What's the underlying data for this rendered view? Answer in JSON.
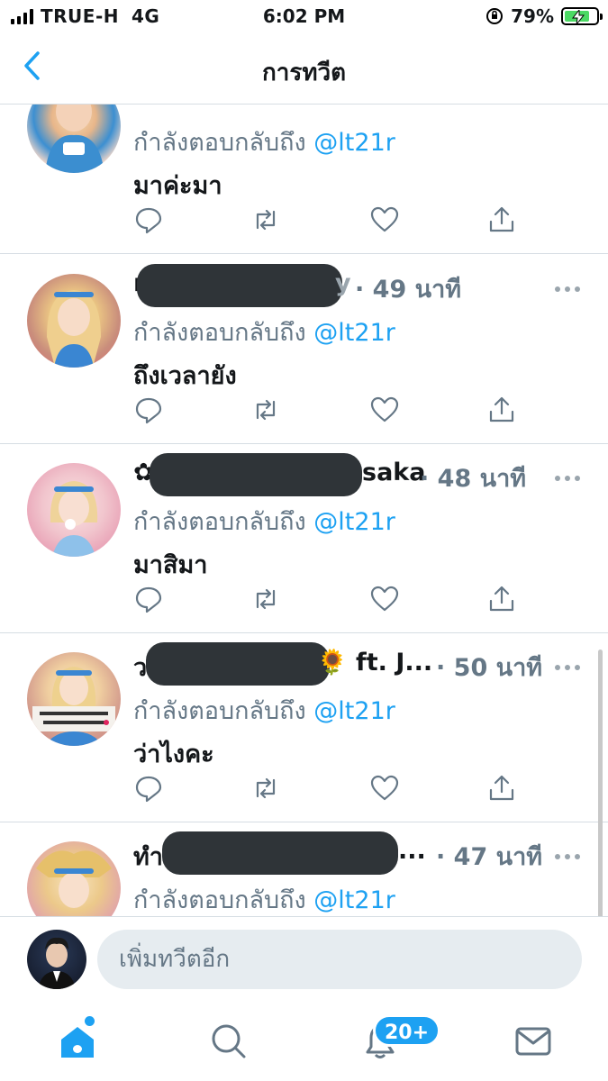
{
  "status_bar": {
    "carrier": "TRUE-H",
    "network": "4G",
    "time": "6:02 PM",
    "battery": "79%",
    "battery_level": 0.79
  },
  "header": {
    "title": "การทวีต",
    "back_icon": "chevron-left-icon"
  },
  "tweets": [
    {
      "name_tail": "",
      "time": "",
      "replying_prefix": "กำลังตอบกลับถึง",
      "mention": "@lt21r",
      "text": "มาค่ะมา"
    },
    {
      "name_tail": "y",
      "time": "· 49 นาที",
      "replying_prefix": "กำลังตอบกลับถึง",
      "mention": "@lt21r",
      "text": "ถึงเวลายัง"
    },
    {
      "name_tail": "saka",
      "time": "· 48 นาที",
      "replying_prefix": "กำลังตอบกลับถึง",
      "mention": "@lt21r",
      "text": "มาสิมา"
    },
    {
      "name_tail": "🌻 ft. J...",
      "time": "· 50 นาที",
      "replying_prefix": "กำลังตอบกลับถึง",
      "mention": "@lt21r",
      "text": "ว่าไงคะ"
    },
    {
      "name_tail": "ทำ",
      "name_ellipsis": "...",
      "time": "· 47 นาที",
      "replying_prefix": "กำลังตอบกลับถึง",
      "mention": "@lt21r",
      "text": ""
    }
  ],
  "compose": {
    "placeholder": "เพิ่มทวีตอีก"
  },
  "tabbar": {
    "notification_badge": "20+"
  },
  "colors": {
    "accent": "#1da1f2",
    "secondary_text": "#657786",
    "divider": "#d6dde3"
  }
}
